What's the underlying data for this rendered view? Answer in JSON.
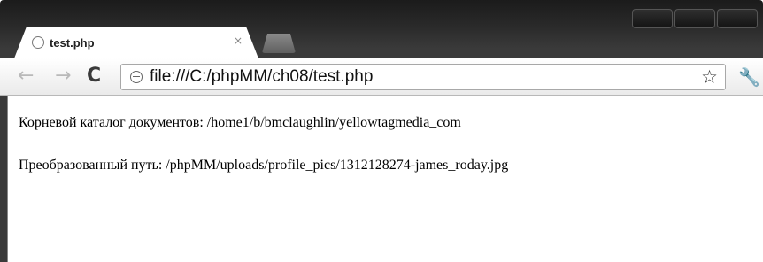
{
  "window": {
    "controls": [
      "minimize",
      "maximize",
      "close"
    ]
  },
  "tab": {
    "title": "test.php",
    "close_label": "×",
    "favicon": "globe-icon"
  },
  "toolbar": {
    "back_label": "←",
    "forward_label": "→",
    "reload_label": "C",
    "url": "file:///C:/phpMM/ch08/test.php",
    "star_label": "☆",
    "wrench_label": "🔧"
  },
  "content": {
    "doc_root": "Корневой каталог документов: /home1/b/bmclaughlin/yellowtagmedia_com",
    "converted_path": "Преобразованный путь: /phpMM/uploads/profile_pics/1312128274-james_roday.jpg"
  }
}
